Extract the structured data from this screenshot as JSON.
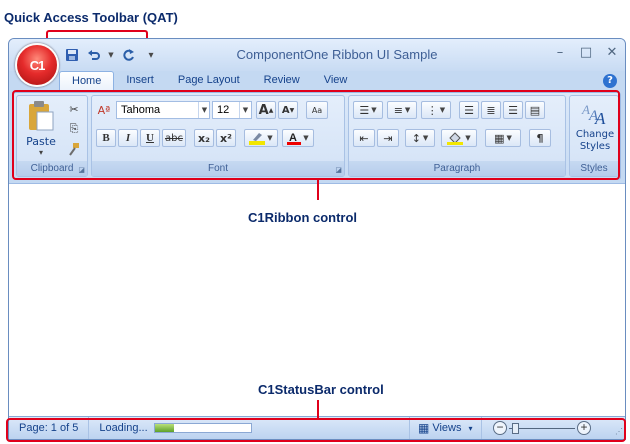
{
  "annotations": {
    "qat": "Quick Access Toolbar (QAT)",
    "ribbon": "C1Ribbon control",
    "statusbar": "C1StatusBar control"
  },
  "window": {
    "title": "ComponentOne Ribbon UI Sample",
    "orb_text": "C1",
    "controls": {
      "minimize": "–",
      "restore": "□",
      "close": "✕"
    }
  },
  "qat": {
    "save": "💾",
    "undo": "↶",
    "redo": "↻",
    "customize": "▾"
  },
  "tabs": [
    "Home",
    "Insert",
    "Page Layout",
    "Review",
    "View"
  ],
  "help": "?",
  "ribbon": {
    "clipboard": {
      "label": "Clipboard",
      "paste": "Paste",
      "paste_arrow": "▾"
    },
    "font": {
      "label": "Font",
      "font_name": "Tahoma",
      "font_size": "12",
      "bold": "B",
      "italic": "I",
      "underline": "U",
      "strike": "abc",
      "subscript": "x₂",
      "superscript": "x²",
      "grow": "A",
      "shrink": "A",
      "clear": "Aa"
    },
    "paragraph": {
      "label": "Paragraph",
      "pilcrow": "¶"
    },
    "styles": {
      "label": "Styles",
      "change_styles": "Change Styles",
      "arrow": "▾"
    }
  },
  "status": {
    "page": "Page: 1 of 5",
    "loading": "Loading...",
    "progress": 0.2,
    "views": "Views",
    "views_arrow": "▾",
    "zoom_out": "−",
    "zoom_in": "+"
  },
  "colors": {
    "accent_red": "#e0001b",
    "label_blue": "#0b2a6b"
  }
}
